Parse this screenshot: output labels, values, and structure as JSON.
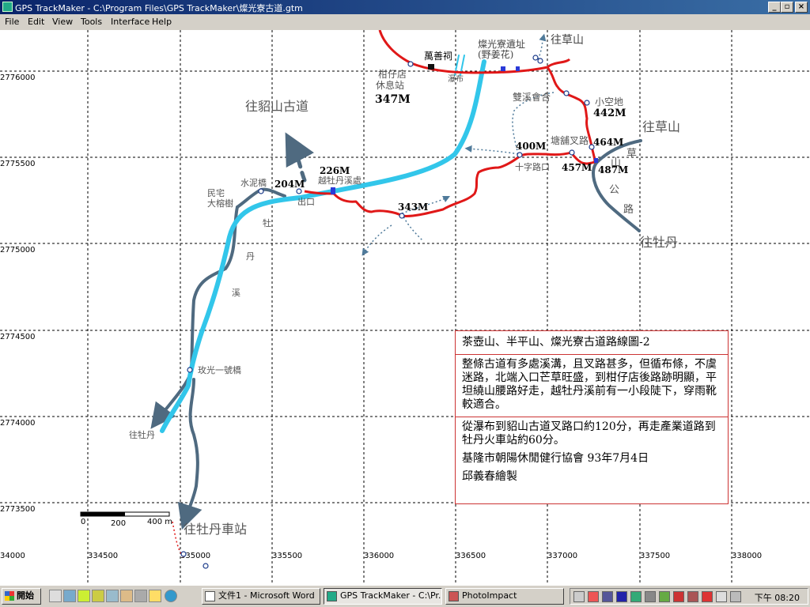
{
  "window": {
    "title": "GPS TrackMaker - C:\\Program Files\\GPS TrackMaker\\燦光寮古道.gtm"
  },
  "menu": [
    "File",
    "Edit",
    "View",
    "Tools",
    "Interface",
    "Help"
  ],
  "map": {
    "y_axis": [
      "2776000",
      "2775500",
      "2775000",
      "2774500",
      "2774000",
      "2773500"
    ],
    "x_axis": [
      "34000",
      "334500",
      "335000",
      "335500",
      "336000",
      "336500",
      "337000",
      "337500",
      "338000"
    ],
    "scale": {
      "zero": "0",
      "mid": "200",
      "end": "400 m"
    },
    "labels": {
      "to_caoshan_top": "往草山",
      "to_caoshan_right": "往草山",
      "ruins": "燦光寮遺址",
      "ruins_sub": "(野姜花)",
      "wanshan": "萬善祠",
      "waterfall": "瀑布",
      "rest_station": "柑仔店",
      "rest_station_2": "休息站",
      "rest_elev": "347M",
      "to_diaoshan": "往貂山古道",
      "shuangxi": "雙溪會合",
      "xiaokongdi": "小空地",
      "e442": "442M",
      "tangpu": "塘舖叉路",
      "e464": "464M",
      "e400": "400M",
      "shizi": "十字路口",
      "e457": "457M",
      "e487": "487M",
      "road_chars": [
        "草",
        "山",
        "公",
        "路"
      ],
      "to_mudan_right": "往牡丹",
      "e226": "226M",
      "cross_mudan": "越牡丹溪處",
      "e204": "204M",
      "cement_bridge": "水泥橋",
      "house": "民宅",
      "banyan": "大榕樹",
      "exit": "出口",
      "e343": "343M",
      "stream_chars": [
        "牡",
        "丹",
        "溪"
      ],
      "bridge1": "玫光一號橋",
      "to_mudan_left": "往牡丹",
      "to_mudan_station": "往牡丹車站"
    },
    "info": {
      "title": "茶壺山、半平山、燦光寮古道路線圖-2",
      "para1": "整條古道有多處溪溝，且叉路甚多，但循布條，不虞迷路，北端入口芒草旺盛，到柑仔店後路跡明顯，平坦繞山腰路好走，越牡丹溪前有一小段陡下，穿雨靴較適合。",
      "para2": "從瀑布到貂山古道叉路口約120分，再走產業道路到牡丹火車站約60分。",
      "para3": "基隆市朝陽休閒健行協會 93年7月4日",
      "para4": "邱義春繪製"
    }
  },
  "taskbar": {
    "start": "開始",
    "tasks": [
      "文件1 - Microsoft Word",
      "GPS TrackMaker - C:\\Pr...",
      "PhotoImpact"
    ],
    "clock": "下午 08:20"
  }
}
